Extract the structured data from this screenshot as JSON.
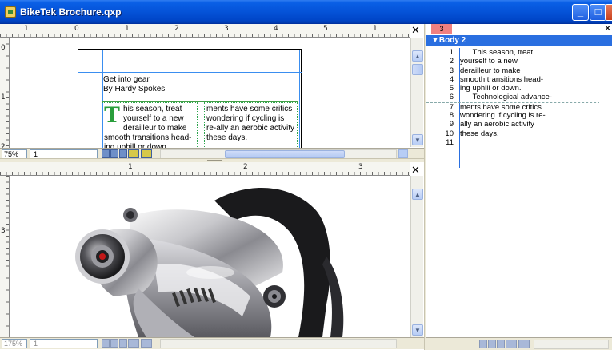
{
  "window": {
    "title": "BikeTek Brochure.qxp"
  },
  "layout_view": {
    "ruler_numbers": [
      "1",
      "0",
      "1",
      "2",
      "3",
      "4",
      "5",
      "1"
    ],
    "vruler_numbers": [
      "0",
      "1",
      "2"
    ],
    "zoom": "75%",
    "page": "1",
    "headline": "Get into gear",
    "byline": "By Hardy Spokes",
    "dropcap": "T",
    "col1_text": "his season, treat yourself to a new derailleur to make smooth transitions head-ing uphill or down.",
    "col2_text": "ments have some critics wondering if cycling is re-ally an aerobic activity these days."
  },
  "image_view": {
    "ruler_numbers": [
      "1",
      "2",
      "3"
    ],
    "vruler_numbers": [
      "3"
    ],
    "zoom": "175%",
    "page": "1"
  },
  "story_editor": {
    "marker": "3",
    "style_name": "▼Body 2",
    "lines": [
      {
        "n": "1",
        "t": "      This season, treat"
      },
      {
        "n": "2",
        "t": "yourself to a new"
      },
      {
        "n": "3",
        "t": "derailleur to make"
      },
      {
        "n": "4",
        "t": "smooth transitions head-"
      },
      {
        "n": "5",
        "t": "ing uphill or down."
      },
      {
        "n": "6",
        "t": "      Technological advance-"
      },
      {
        "n": "7",
        "t": "ments have some critics"
      },
      {
        "n": "8",
        "t": "wondering if cycling is re-"
      },
      {
        "n": "9",
        "t": "ally an aerobic activity"
      },
      {
        "n": "10",
        "t": "these days."
      },
      {
        "n": "11",
        "t": ""
      }
    ]
  },
  "icons": {
    "close": "✕",
    "up": "▲",
    "down": "▼",
    "left": "◀",
    "right": "▶",
    "minimize": "_",
    "maximize": "□"
  }
}
